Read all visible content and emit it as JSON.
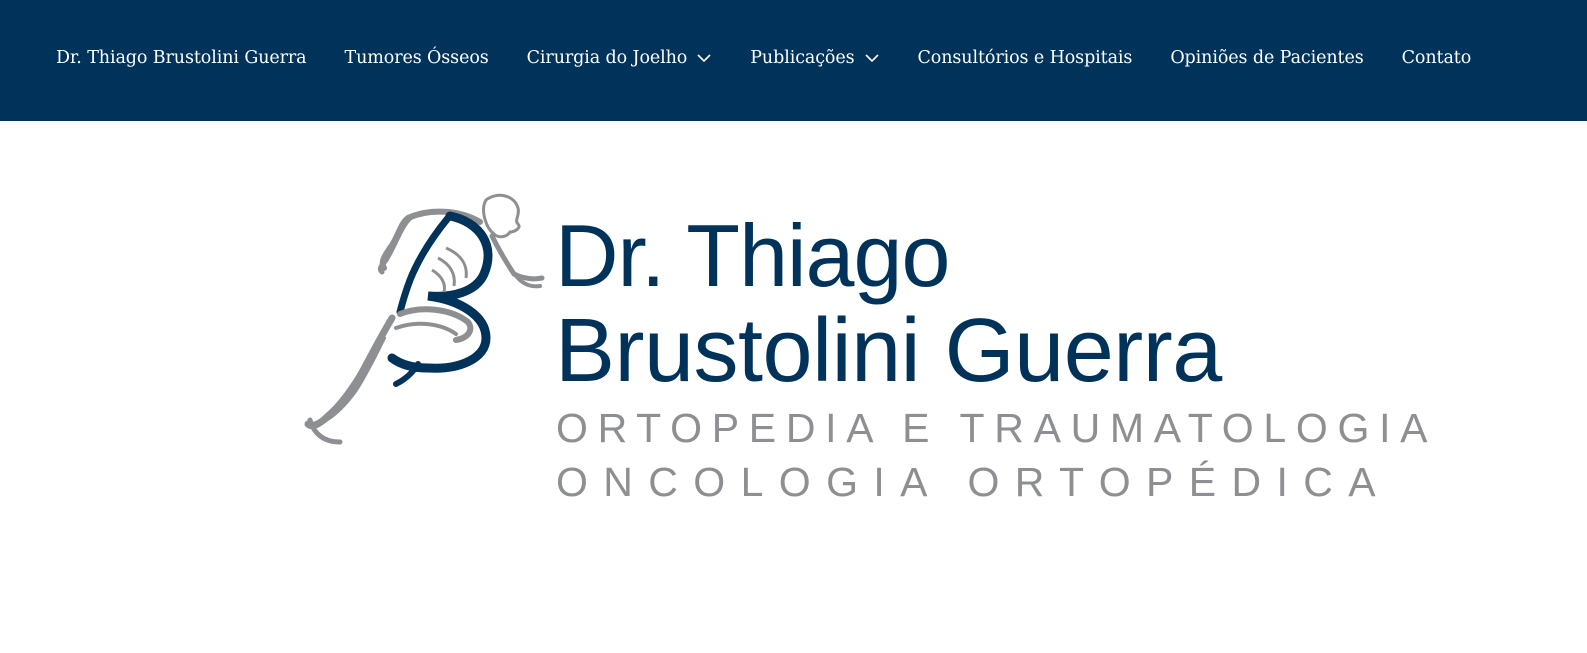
{
  "nav": {
    "items": [
      {
        "label": "Dr. Thiago Brustolini Guerra",
        "has_dropdown": false
      },
      {
        "label": "Tumores Ósseos",
        "has_dropdown": false
      },
      {
        "label": "Cirurgia do Joelho",
        "has_dropdown": true
      },
      {
        "label": "Publicações",
        "has_dropdown": true
      },
      {
        "label": "Consultórios e Hospitais",
        "has_dropdown": false
      },
      {
        "label": "Opiniões de Pacientes",
        "has_dropdown": false
      },
      {
        "label": "Contato",
        "has_dropdown": false
      }
    ]
  },
  "logo": {
    "line1": "Dr. Thiago",
    "line2": "Brustolini Guerra",
    "line3": "ORTOPEDIA E TRAUMATOLOGIA",
    "line4": "ONCOLOGIA ORTOPÉDICA",
    "icon": "running-figure-icon"
  },
  "colors": {
    "navbar_bg": "#01335a",
    "brand_blue": "#01335a",
    "brand_gray": "#8e8f92",
    "nav_text": "#ffffff"
  }
}
